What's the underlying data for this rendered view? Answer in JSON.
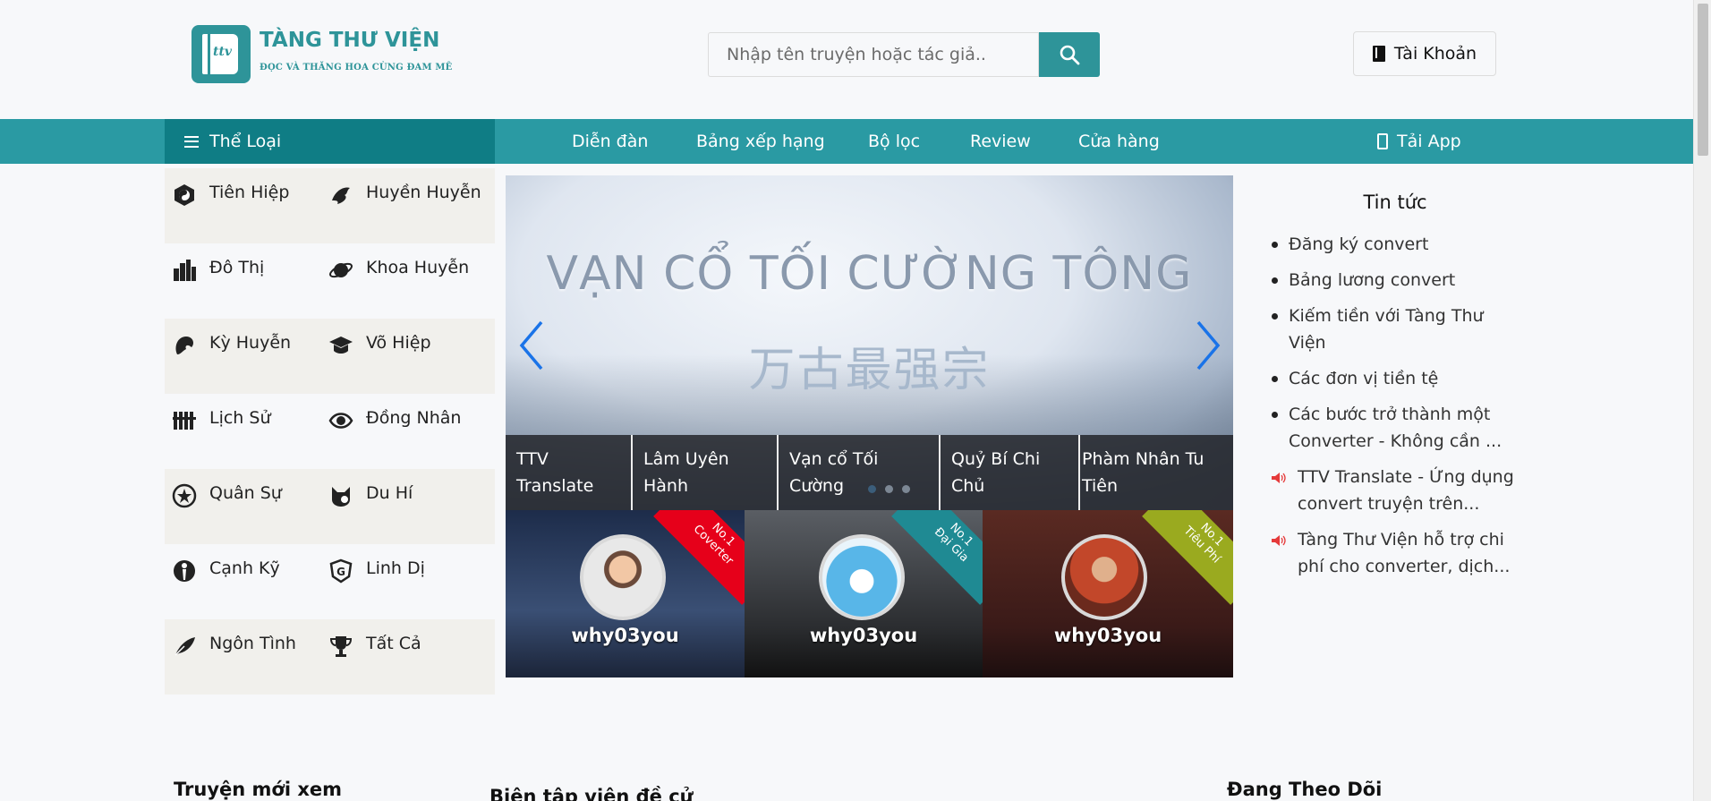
{
  "logo": {
    "mark": "ttv",
    "title": "TÀNG THƯ VIỆN",
    "tagline": "ĐỌC VÀ THĂNG HOA CÙNG ĐAM MÊ"
  },
  "search": {
    "placeholder": "Nhập tên truyện hoặc tác giả..",
    "value": ""
  },
  "account": {
    "label": "Tài Khoản"
  },
  "nav": {
    "category_label": "Thể Loại",
    "items": [
      "Diễn đàn",
      "Bảng xếp hạng",
      "Bộ lọc",
      "Review",
      "Cửa hàng"
    ],
    "app_label": "Tải App"
  },
  "categories": [
    {
      "label": "Tiên Hiệp",
      "icon": "yin-yang-icon"
    },
    {
      "label": "Huyền Huyễn",
      "icon": "dragon-icon"
    },
    {
      "label": "Đô Thị",
      "icon": "city-icon"
    },
    {
      "label": "Khoa Huyễn",
      "icon": "planet-icon"
    },
    {
      "label": "Kỳ Huyễn",
      "icon": "fantasy-dragon-icon"
    },
    {
      "label": "Võ Hiệp",
      "icon": "graduation-cap-icon"
    },
    {
      "label": "Lịch Sử",
      "icon": "history-icon"
    },
    {
      "label": "Đồng Nhân",
      "icon": "eye-icon"
    },
    {
      "label": "Quân Sự",
      "icon": "military-badge-icon"
    },
    {
      "label": "Du Hí",
      "icon": "cat-game-icon"
    },
    {
      "label": "Cạnh Kỹ",
      "icon": "athlete-icon"
    },
    {
      "label": "Linh Dị",
      "icon": "ghost-shield-icon"
    },
    {
      "label": "Ngôn Tình",
      "icon": "feather-icon"
    },
    {
      "label": "Tất Cả",
      "icon": "trophy-icon"
    }
  ],
  "banner": {
    "title": "VẠN CỔ TỐI CƯỜNG TÔNG",
    "subtitle_cn": "万古最强宗",
    "slides": [
      "TTV Translate",
      "Lâm Uyên Hành",
      "Vạn cổ Tối Cường",
      "Quỷ Bí Chi Chủ",
      "Phàm Nhân Tu Tiên"
    ],
    "active_slide": 0
  },
  "top_users": [
    {
      "name": "why03you",
      "rank": "No.1",
      "category": "Coverter",
      "ribbon_color": "#e6001a"
    },
    {
      "name": "why03you",
      "rank": "No.1",
      "category": "Đại Gia",
      "ribbon_color": "#1f8a93"
    },
    {
      "name": "why03you",
      "rank": "No.1",
      "category": "Tiêu Phí",
      "ribbon_color": "#9aaa1f"
    }
  ],
  "news": {
    "title": "Tin tức",
    "items": [
      "Đăng ký convert",
      "Bảng lương convert",
      "Kiếm tiền với Tàng Thư Viện",
      "Các đơn vị tiền tệ",
      "Các bước trở thành một Converter - Không cần ..."
    ],
    "announcements": [
      "TTV Translate - Ứng dụng convert truyện trên...",
      "Tàng Thư Viện hỗ trợ chi phí cho converter, dịch..."
    ]
  },
  "sections": {
    "recent": "Truyện mới xem",
    "editor": "Biên tập viên đề cử",
    "following": "Đang Theo Dõi"
  },
  "colors": {
    "brand": "#2e9499",
    "nav": "#2a9aa3",
    "nav_dark": "#0f7d85"
  }
}
